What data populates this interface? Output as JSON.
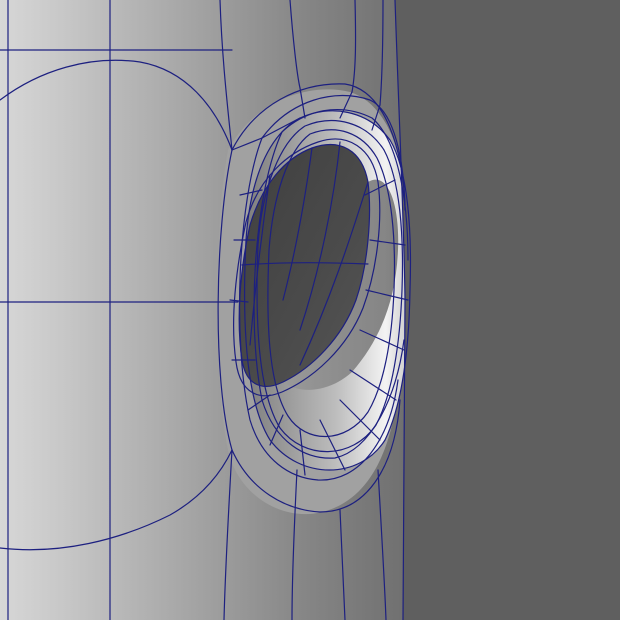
{
  "scene": {
    "subject": "cylinder-with-flanged-hole",
    "colors": {
      "background": "#5f5f5f",
      "surface_light": "#d2d2d2",
      "surface_mid": "#9b9b9b",
      "surface_dark": "#646464",
      "hole_interior": "#4a4a4a",
      "wireframe": "#1d2080"
    }
  }
}
